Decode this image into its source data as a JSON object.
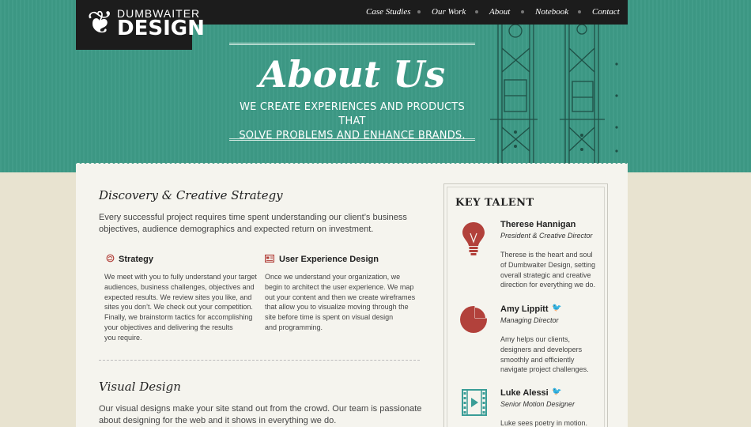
{
  "logo": {
    "top": "DUMBWAITER",
    "big": "DESIGN",
    "ornament": "❦"
  },
  "nav": {
    "items": [
      {
        "label": "Case Studies"
      },
      {
        "label": "Our Work"
      },
      {
        "label": "About"
      },
      {
        "label": "Notebook"
      },
      {
        "label": "Contact"
      }
    ]
  },
  "hero": {
    "title": "About Us",
    "tagline_line1": "WE CREATE EXPERIENCES AND PRODUCTS THAT",
    "tagline_line2": "SOLVE PROBLEMS AND ENHANCE BRANDS."
  },
  "discovery": {
    "heading": "Discovery & Creative Strategy",
    "intro_line1": "Every successful project requires time spent understanding our client’s business",
    "intro_line2": "objectives, audience demographics and expected return on investment.",
    "strategy": {
      "title": "Strategy",
      "lines": [
        "We meet with you to fully understand your target",
        "audiences, business challenges, objectives and",
        "expected results. We review sites you like, and",
        "sites you don’t. We check out your competition.",
        "Finally, we brainstorm tactics for accomplishing",
        "your objectives and delivering the results",
        "you require."
      ]
    },
    "ux": {
      "title": "User Experience Design",
      "lines": [
        "Once we understand your organization, we",
        "begin to architect the user experience. We map",
        "out your content and then we create wireframes",
        "that allow you to visualize moving through the",
        "site before time is spent on visual design",
        "and programming."
      ]
    }
  },
  "visual": {
    "heading": "Visual Design",
    "intro_line1": "Our visual designs make your site stand out from the crowd. Our team is passionate",
    "intro_line2": "about designing for the web and it shows in everything we do."
  },
  "talent": {
    "title": "KEY TALENT",
    "people": [
      {
        "name": "Therese Hannigan",
        "role": "President & Creative Director",
        "bio": [
          "Therese is the heart and soul",
          "of Dumbwaiter Design, setting",
          "overall strategic and creative",
          "direction for everything we do."
        ]
      },
      {
        "name": "Amy Lippitt",
        "role": "Managing Director",
        "bio": [
          "Amy helps our clients,",
          "designers and developers",
          "smoothly and efficiently",
          "navigate project challenges."
        ]
      },
      {
        "name": "Luke Alessi",
        "role": "Senior Motion Designer",
        "bio": [
          "Luke sees poetry in motion."
        ]
      }
    ]
  },
  "colors": {
    "hero_teal": "#3d9a86",
    "dark": "#1c1c1c",
    "icon_red": "#b2413b",
    "icon_teal": "#3a9d97"
  },
  "icons": {
    "twitter": "twitter-bird-icon",
    "bulb": "lightbulb-icon",
    "pie": "pie-chart-icon",
    "film": "film-strip-icon"
  }
}
